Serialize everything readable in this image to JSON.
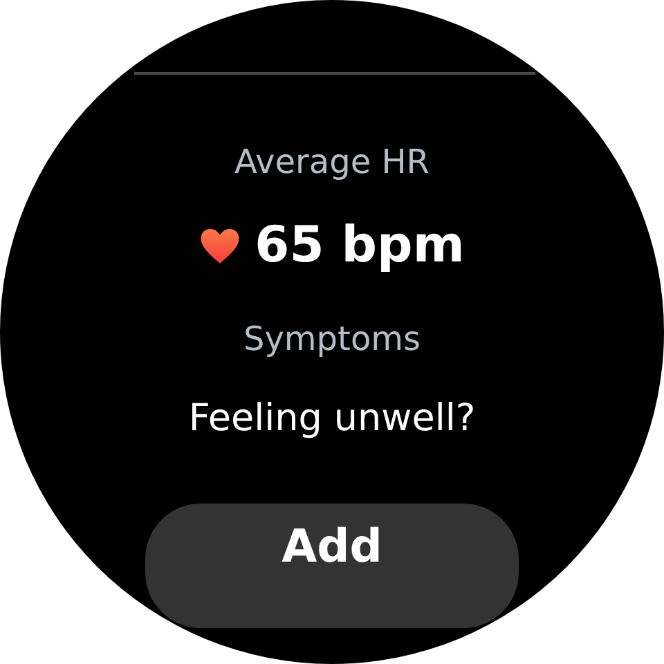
{
  "average_hr": {
    "label": "Average HR",
    "value": "65 bpm"
  },
  "symptoms": {
    "label": "Symptoms",
    "prompt": "Feeling unwell?"
  },
  "buttons": [
    {
      "label": "Add",
      "kind": "primary"
    }
  ]
}
